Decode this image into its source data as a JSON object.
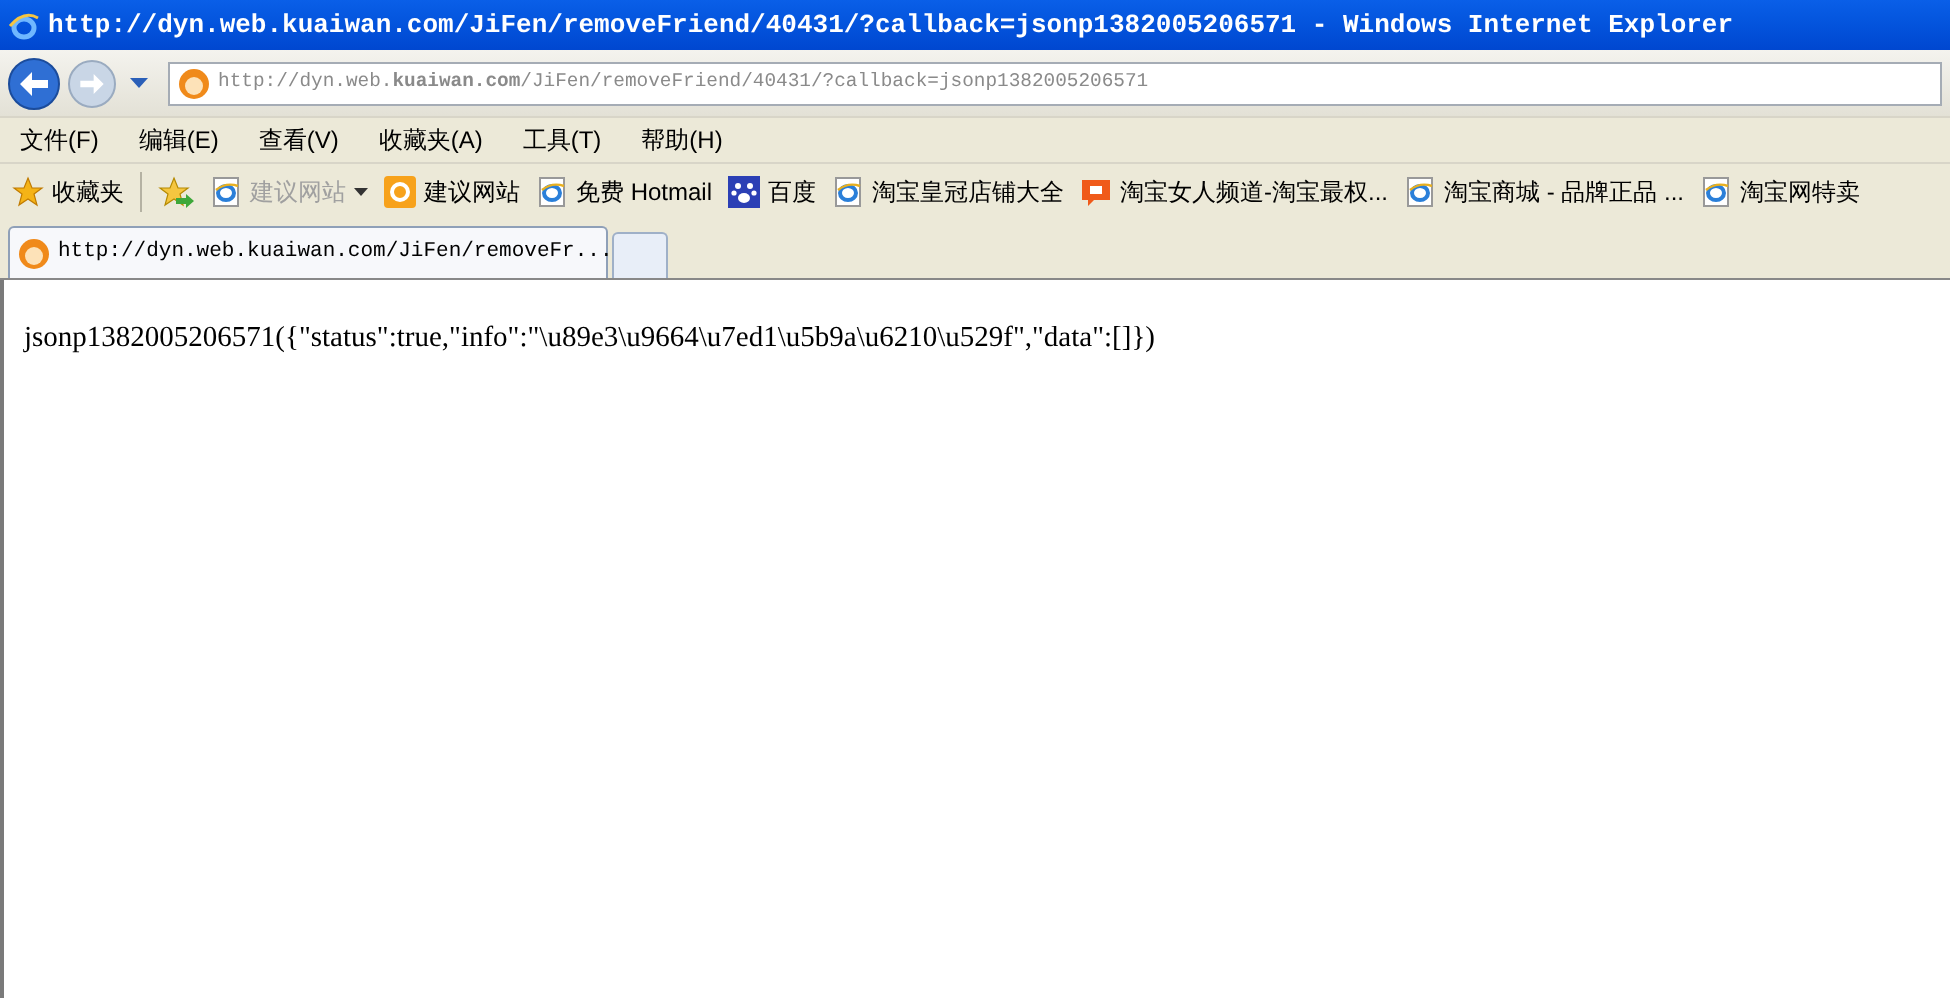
{
  "window": {
    "title": "http://dyn.web.kuaiwan.com/JiFen/removeFriend/40431/?callback=jsonp1382005206571 - Windows Internet Explorer"
  },
  "address_bar": {
    "url": "http://dyn.web.**kuaiwan.com**/JiFen/removeFriend/40431/?callback=jsonp1382005206571"
  },
  "menu": [
    "文件(F)",
    "编辑(E)",
    "查看(V)",
    "收藏夹(A)",
    "工具(T)",
    "帮助(H)"
  ],
  "favorites_bar": {
    "label": "收藏夹",
    "items": [
      {
        "kind": "ie",
        "label": "建议网站",
        "disabled": true,
        "dropdown": true
      },
      {
        "kind": "orange",
        "label": "建议网站",
        "disabled": false,
        "dropdown": false
      },
      {
        "kind": "ie",
        "label": "免费 Hotmail",
        "disabled": false,
        "dropdown": false
      },
      {
        "kind": "paw",
        "label": "百度",
        "disabled": false,
        "dropdown": false
      },
      {
        "kind": "ie",
        "label": "淘宝皇冠店铺大全",
        "disabled": false,
        "dropdown": false
      },
      {
        "kind": "taobao",
        "label": "淘宝女人频道-淘宝最权...",
        "disabled": false,
        "dropdown": false
      },
      {
        "kind": "ie",
        "label": "淘宝商城 - 品牌正品 ...",
        "disabled": false,
        "dropdown": false
      },
      {
        "kind": "ie",
        "label": "淘宝网特卖",
        "disabled": false,
        "dropdown": false
      }
    ]
  },
  "tabs": [
    {
      "label": "http://dyn.web.kuaiwan.com/JiFen/removeFr...",
      "selected": true
    }
  ],
  "content": {
    "text": "jsonp1382005206571({\"status\":true,\"info\":\"\\u89e3\\u9664\\u7ed1\\u5b9a\\u6210\\u529f\",\"data\":[]})"
  }
}
